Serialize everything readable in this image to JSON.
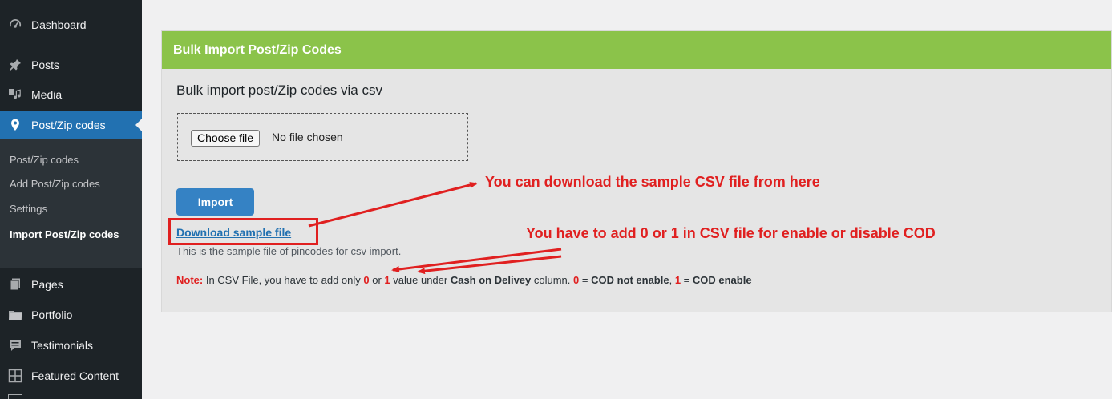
{
  "sidebar": {
    "items": [
      {
        "label": "Dashboard",
        "icon": "dashboard-icon"
      },
      {
        "label": "Posts",
        "icon": "pin-icon"
      },
      {
        "label": "Media",
        "icon": "media-icon"
      },
      {
        "label": "Post/Zip codes",
        "icon": "location-pin-icon",
        "active": true
      },
      {
        "label": "Pages",
        "icon": "pages-icon"
      },
      {
        "label": "Portfolio",
        "icon": "folder-icon"
      },
      {
        "label": "Testimonials",
        "icon": "testimonial-icon"
      },
      {
        "label": "Featured Content",
        "icon": "grid-icon"
      }
    ],
    "submenu": [
      {
        "label": "Post/Zip codes"
      },
      {
        "label": "Add Post/Zip codes"
      },
      {
        "label": "Settings"
      },
      {
        "label": "Import Post/Zip codes",
        "current": true
      }
    ]
  },
  "panel": {
    "header": "Bulk Import Post/Zip Codes",
    "subtitle": "Bulk import post/Zip codes via csv",
    "choose_file_label": "Choose file",
    "no_file_text": "No file chosen",
    "import_label": "Import",
    "download_link": "Download sample file",
    "sample_desc": "This is the sample file of pincodes for csv import.",
    "note": {
      "label": "Note:",
      "t1": " In CSV File, you have to add only ",
      "zero": "0",
      "t2": " or ",
      "one": "1",
      "t3": " value under ",
      "column": "Cash on Delivey",
      "t4": " column. ",
      "zero2": "0",
      "t5": " = ",
      "cod_not": "COD not enable",
      "t6": ", ",
      "one2": "1",
      "t7": " = ",
      "cod_enable": "COD enable"
    }
  },
  "annotations": {
    "callout1": "You can download the sample CSV file from here",
    "callout2": "You have to add 0 or 1 in CSV file for enable or disable COD"
  },
  "colors": {
    "sidebar_bg": "#1d2327",
    "active_item": "#2271b1",
    "header_green": "#8bc34a",
    "import_button": "#3582c4",
    "annotation_red": "#e02020"
  }
}
